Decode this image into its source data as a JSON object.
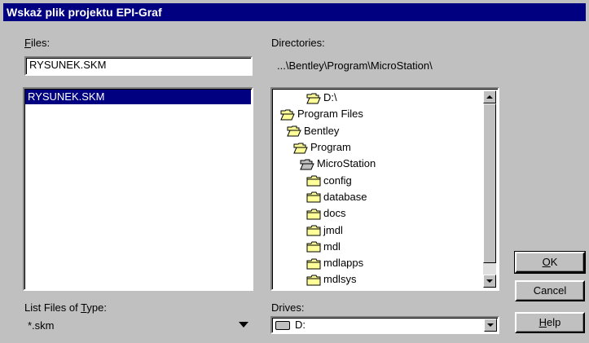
{
  "window": {
    "title": "Wskaż plik projektu EPI-Graf"
  },
  "files": {
    "label_prefix": "F",
    "label_rest": "iles:",
    "input_value": "RYSUNEK.SKM",
    "items": [
      "RYSUNEK.SKM"
    ],
    "selected_index": 0
  },
  "directories": {
    "label": "Directories:",
    "current_path": "...\\Bentley\\Program\\MicroStation\\",
    "items": [
      {
        "name": "D:\\",
        "state": "open"
      },
      {
        "name": "Program Files",
        "state": "open"
      },
      {
        "name": "Bentley",
        "state": "open"
      },
      {
        "name": "Program",
        "state": "open"
      },
      {
        "name": "MicroStation",
        "state": "current"
      },
      {
        "name": "config",
        "state": "closed"
      },
      {
        "name": "database",
        "state": "closed"
      },
      {
        "name": "docs",
        "state": "closed"
      },
      {
        "name": "jmdl",
        "state": "closed"
      },
      {
        "name": "mdl",
        "state": "closed"
      },
      {
        "name": "mdlapps",
        "state": "closed"
      },
      {
        "name": "mdlsys",
        "state": "closed"
      }
    ]
  },
  "file_type": {
    "label_pre": "List Files of ",
    "label_key": "T",
    "label_post": "ype:",
    "selected": "*.skm"
  },
  "drives": {
    "label": "Drives:",
    "selected": "D:"
  },
  "buttons": {
    "ok_key": "O",
    "ok_rest": "K",
    "cancel": "Cancel",
    "help_key": "H",
    "help_rest": "elp"
  },
  "colors": {
    "titlebar": "#000080",
    "selection": "#000080",
    "face": "#c0c0c0"
  }
}
